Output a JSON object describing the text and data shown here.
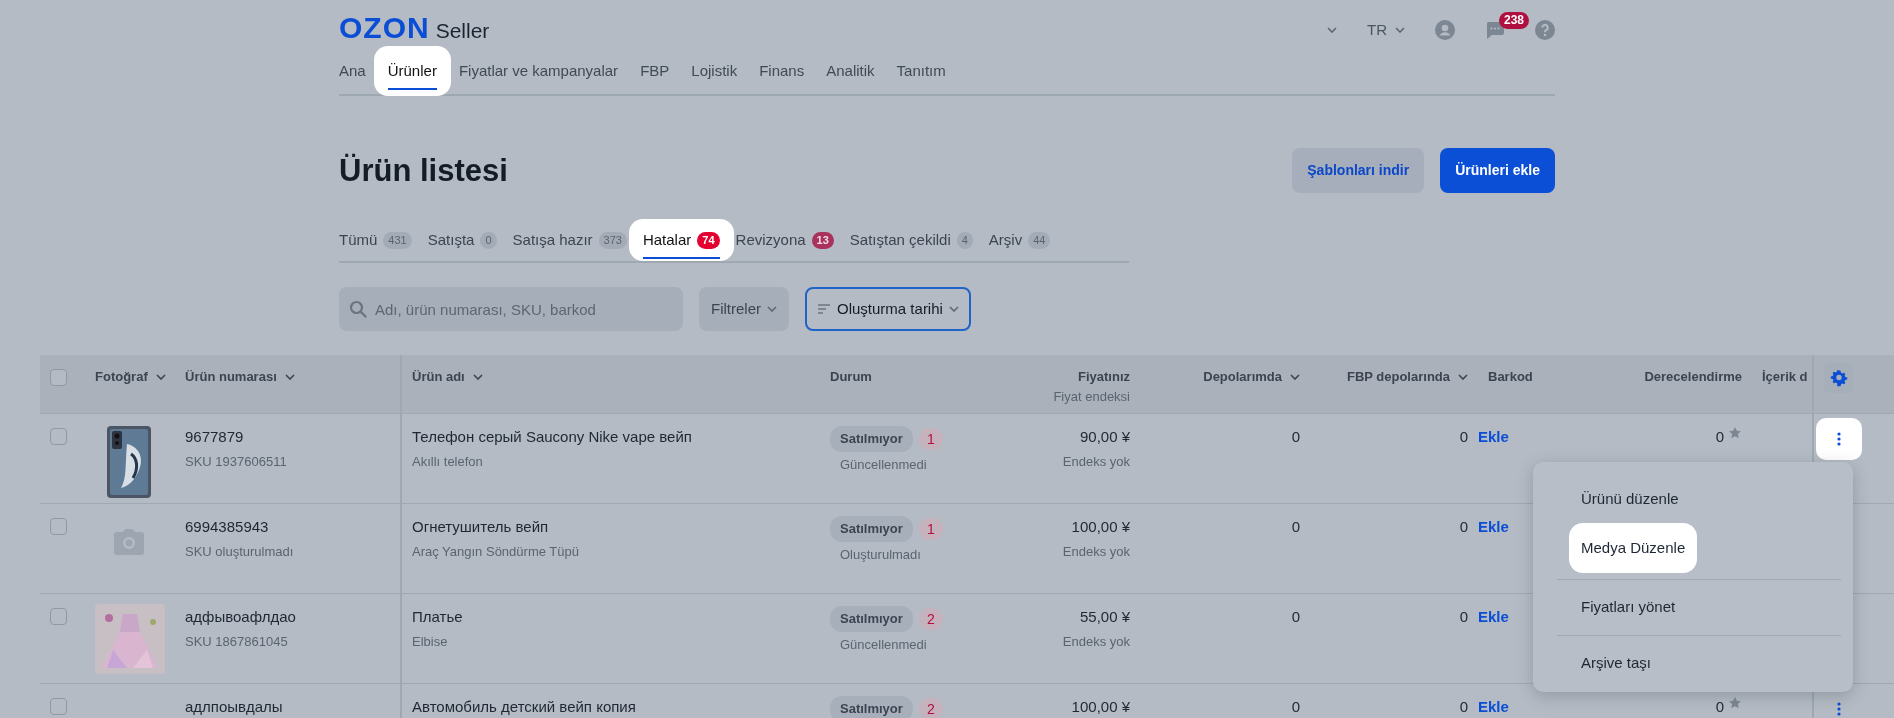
{
  "header": {
    "logo": "OZON",
    "logo_suffix": "Seller",
    "language": "TR",
    "messages_badge": "238"
  },
  "nav": [
    {
      "label": "Ana",
      "selected": false,
      "highlighted": false
    },
    {
      "label": "Ürünler",
      "selected": true,
      "highlighted": true
    },
    {
      "label": "Fiyatlar ve kampanyalar",
      "selected": false,
      "highlighted": false
    },
    {
      "label": "FBP",
      "selected": false,
      "highlighted": false
    },
    {
      "label": "Lojistik",
      "selected": false,
      "highlighted": false
    },
    {
      "label": "Finans",
      "selected": false,
      "highlighted": false
    },
    {
      "label": "Analitik",
      "selected": false,
      "highlighted": false
    },
    {
      "label": "Tanıtım",
      "selected": false,
      "highlighted": false
    }
  ],
  "page_title": "Ürün listesi",
  "actions": [
    {
      "label": "Şablonları indir",
      "kind": "secondary"
    },
    {
      "label": "Ürünleri ekle",
      "kind": "primary"
    }
  ],
  "tabs": [
    {
      "label": "Tümü",
      "count": "431",
      "alert": false,
      "selected": false,
      "highlighted": false
    },
    {
      "label": "Satışta",
      "count": "0",
      "alert": false,
      "selected": false,
      "highlighted": false
    },
    {
      "label": "Satışa hazır",
      "count": "373",
      "alert": false,
      "selected": false,
      "highlighted": false
    },
    {
      "label": "Hatalar",
      "count": "74",
      "alert": true,
      "selected": true,
      "highlighted": true
    },
    {
      "label": "Revizyona",
      "count": "13",
      "alert": true,
      "selected": false,
      "highlighted": false
    },
    {
      "label": "Satıştan çekildi",
      "count": "4",
      "alert": false,
      "selected": false,
      "highlighted": false
    },
    {
      "label": "Arşiv",
      "count": "44",
      "alert": false,
      "selected": false,
      "highlighted": false
    }
  ],
  "search": {
    "placeholder": "Adı, ürün numarası, SKU, barkod"
  },
  "filter_button": "Filtreler",
  "sort_button": "Oluşturma tarihi",
  "table": {
    "select_all_checked": false,
    "columns": [
      {
        "label": "Fotoğraf",
        "sortable": true
      },
      {
        "label": "Ürün numarası",
        "sortable": true
      },
      {
        "label": "Ürün adı",
        "sortable": true
      },
      {
        "label": "Durum",
        "sortable": false
      },
      {
        "label": "Fiyatınız",
        "sublabel": "Fiyat endeksi",
        "sortable": false
      },
      {
        "label": "Depolarımda",
        "sortable": true
      },
      {
        "label": "FBP depolarında",
        "sortable": true
      },
      {
        "label": "Barkod",
        "sortable": false
      },
      {
        "label": "Derecelendirme",
        "sortable": false
      },
      {
        "label": "İçerik d",
        "sortable": false
      }
    ],
    "rows": [
      {
        "checked": false,
        "number": "9677879",
        "sku": "SKU 1937606511",
        "name": "Телефон серый Saucony Nike vape вейп",
        "category": "Akıllı telefon",
        "status": "Satılmıyor",
        "errors": "1",
        "status_note": "Güncellenmedi",
        "price": "90,00 ¥",
        "price_index": "Endeks yok",
        "stock": "0",
        "fbp_stock": "0",
        "barcode": "Ekle",
        "rating": "0",
        "more_button": {
          "highlighted": true
        }
      },
      {
        "checked": false,
        "photo": {
          "kind": "placeholder"
        },
        "number": "6994385943",
        "sku": "SKU oluşturulmadı",
        "name": "Огнетушитель вейп",
        "category": "Araç Yangın Söndürme Tüpü",
        "status": "Satılmıyor",
        "errors": "1",
        "status_note": "Oluşturulmadı",
        "price": "100,00 ¥",
        "price_index": "Endeks yok",
        "stock": "0",
        "fbp_stock": "0",
        "barcode": "Ekle"
      },
      {
        "checked": false,
        "number": "адфывоафлдао",
        "sku": "SKU 1867861045",
        "name": "Платье",
        "category": "Elbise",
        "status": "Satılmıyor",
        "errors": "2",
        "status_note": "Güncellenmedi",
        "price": "55,00 ¥",
        "price_index": "Endeks yok",
        "stock": "0",
        "fbp_stock": "0",
        "barcode": "Ekle"
      },
      {
        "checked": false,
        "number": "адлпоывдалы",
        "name": "Автомобиль детский вейп копия",
        "status": "Satılmıyor",
        "errors": "2",
        "price": "100,00 ¥",
        "stock": "0",
        "fbp_stock": "0",
        "barcode": "Ekle",
        "rating": "0",
        "more_button": {
          "highlighted": false
        }
      }
    ]
  },
  "row_menu": {
    "groups": [
      [
        {
          "label": "Ürünü düzenle",
          "highlighted": false
        },
        {
          "label": "Medya Düzenle",
          "highlighted": true
        }
      ],
      [
        {
          "label": "Fiyatları yönet",
          "highlighted": false
        }
      ],
      [
        {
          "label": "Arşive taşı",
          "highlighted": false
        }
      ]
    ]
  }
}
